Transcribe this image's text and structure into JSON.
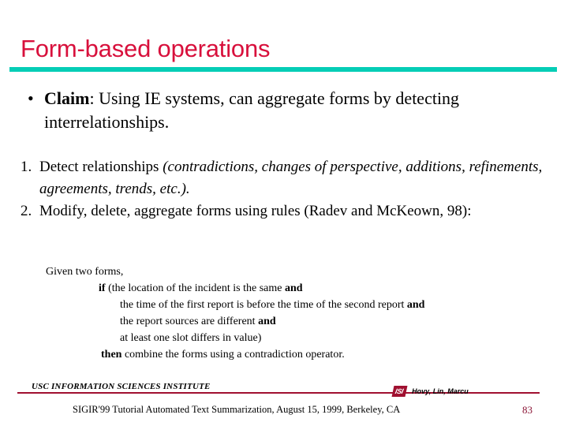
{
  "slide": {
    "title": "Form-based operations",
    "accent_color": "#05cdb6",
    "title_color": "#d8103c",
    "footer_rule_color": "#a01030"
  },
  "claim": {
    "bullet_glyph": "•",
    "keyword": "Claim",
    "separator": ":",
    "text": "  Using IE systems, can aggregate forms by detecting interrelationships."
  },
  "numbered_list": [
    {
      "marker": "1.",
      "lead": "Detect relationships ",
      "italic": "(contradictions, changes of perspective, additions, refinements, agreements, trends, etc.)."
    },
    {
      "marker": "2.",
      "lead": "Modify, delete, aggregate forms using rules (Radev and McKeown, 98):",
      "italic": ""
    }
  ],
  "pseudocode": [
    {
      "level": 1,
      "pre": "Given two forms,",
      "bold": "",
      "post": ""
    },
    {
      "level": 2,
      "pre": "",
      "bold": "if",
      "post": " (the location of the incident is the same ",
      "bold2": "and"
    },
    {
      "level": 3,
      "pre": "the time of the first report is before the time of the second report ",
      "bold": "",
      "post": "",
      "bold2": "and"
    },
    {
      "level": 3,
      "pre": "the report sources are different ",
      "bold": "",
      "post": "",
      "bold2": "and"
    },
    {
      "level": 3,
      "pre": "at least one slot differs in value)",
      "bold": "",
      "post": "",
      "bold2": ""
    },
    {
      "level": 4,
      "pre": "",
      "bold": "then",
      "post": " combine the forms using a contradiction operator.",
      "bold2": ""
    }
  ],
  "footer": {
    "institute": "USC INFORMATION SCIENCES INSTITUTE",
    "logo_text": "ISI",
    "authors": "Hovy, Lin, Marcu",
    "tutorial_line": "SIGIR'99 Tutorial Automated Text Summarization, August 15, 1999, Berkeley, CA",
    "page_number": "83"
  }
}
